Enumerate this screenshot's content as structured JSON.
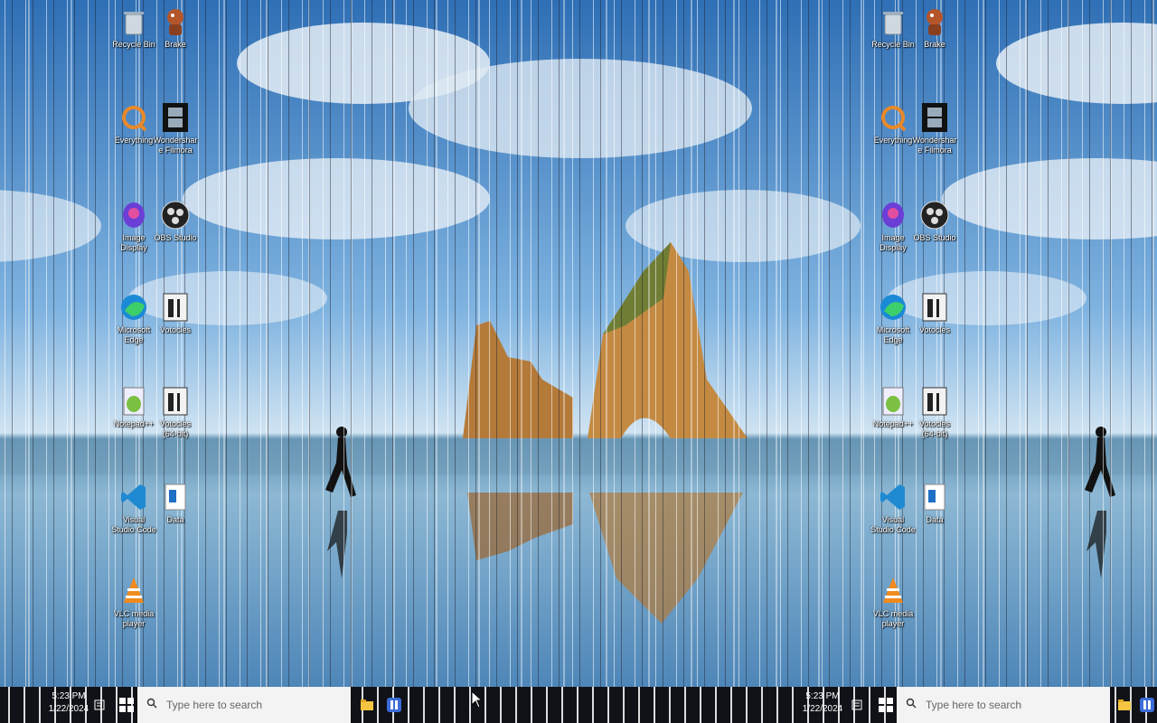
{
  "colors": {
    "taskbar": "#101218",
    "search_bg": "#f3f3f3",
    "sky": "#3a78b8"
  },
  "desktop": {
    "icons": [
      {
        "label": "Recycle Bin",
        "icon": "recycle-bin-icon"
      },
      {
        "label": "Brake",
        "icon": "brake-icon"
      },
      {
        "label": "Everything",
        "icon": "everything-icon"
      },
      {
        "label": "Wondershare Filmora",
        "icon": "filmora-icon"
      },
      {
        "label": "Image Display",
        "icon": "image-display-icon"
      },
      {
        "label": "OBS Studio",
        "icon": "obs-icon"
      },
      {
        "label": "Microsoft Edge",
        "icon": "edge-icon"
      },
      {
        "label": "Votocles",
        "icon": "votocles-icon"
      },
      {
        "label": "Notepad++",
        "icon": "notepad-plus-icon"
      },
      {
        "label": "Votocles (64-bit)",
        "icon": "votocles-64-icon"
      },
      {
        "label": "Visual Studio Code",
        "icon": "vscode-icon"
      },
      {
        "label": "Data",
        "icon": "data-icon"
      },
      {
        "label": "VLC media player",
        "icon": "vlc-icon"
      }
    ]
  },
  "taskbar": {
    "search_placeholder": "Type here to search",
    "clock_time": "5:23 PM",
    "clock_date": "1/22/2024",
    "start_icon": "windows-start-icon",
    "pinned": [
      "file-explorer-icon",
      "app-icon"
    ]
  }
}
